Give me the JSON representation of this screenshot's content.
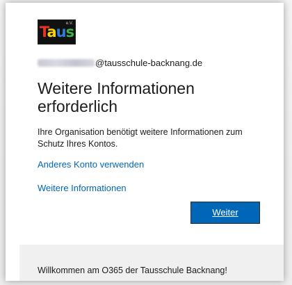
{
  "logo": {
    "letters": [
      "T",
      "a",
      "u",
      "s"
    ],
    "superscript": "e.V.",
    "colors": {
      "t": "#e8322b",
      "a": "#f6d30f",
      "u": "#2f7bd6",
      "s": "#3fb24a"
    }
  },
  "account": {
    "domain": "@tausschule-backnang.de"
  },
  "heading": {
    "title": "Weitere Informationen erforderlich"
  },
  "description": "Ihre Organisation benötigt weitere Informationen zum Schutz Ihres Kontos.",
  "links": {
    "other_account": "Anderes Konto verwenden",
    "more_info": "Weitere Informationen"
  },
  "actions": {
    "next_label": "Weiter"
  },
  "footer": {
    "text": "Willkommen am O365 der Tausschule Backnang!"
  },
  "colors": {
    "accent": "#0067b8",
    "text": "#1b1b1b",
    "footer_bg": "#f0f0f0"
  }
}
